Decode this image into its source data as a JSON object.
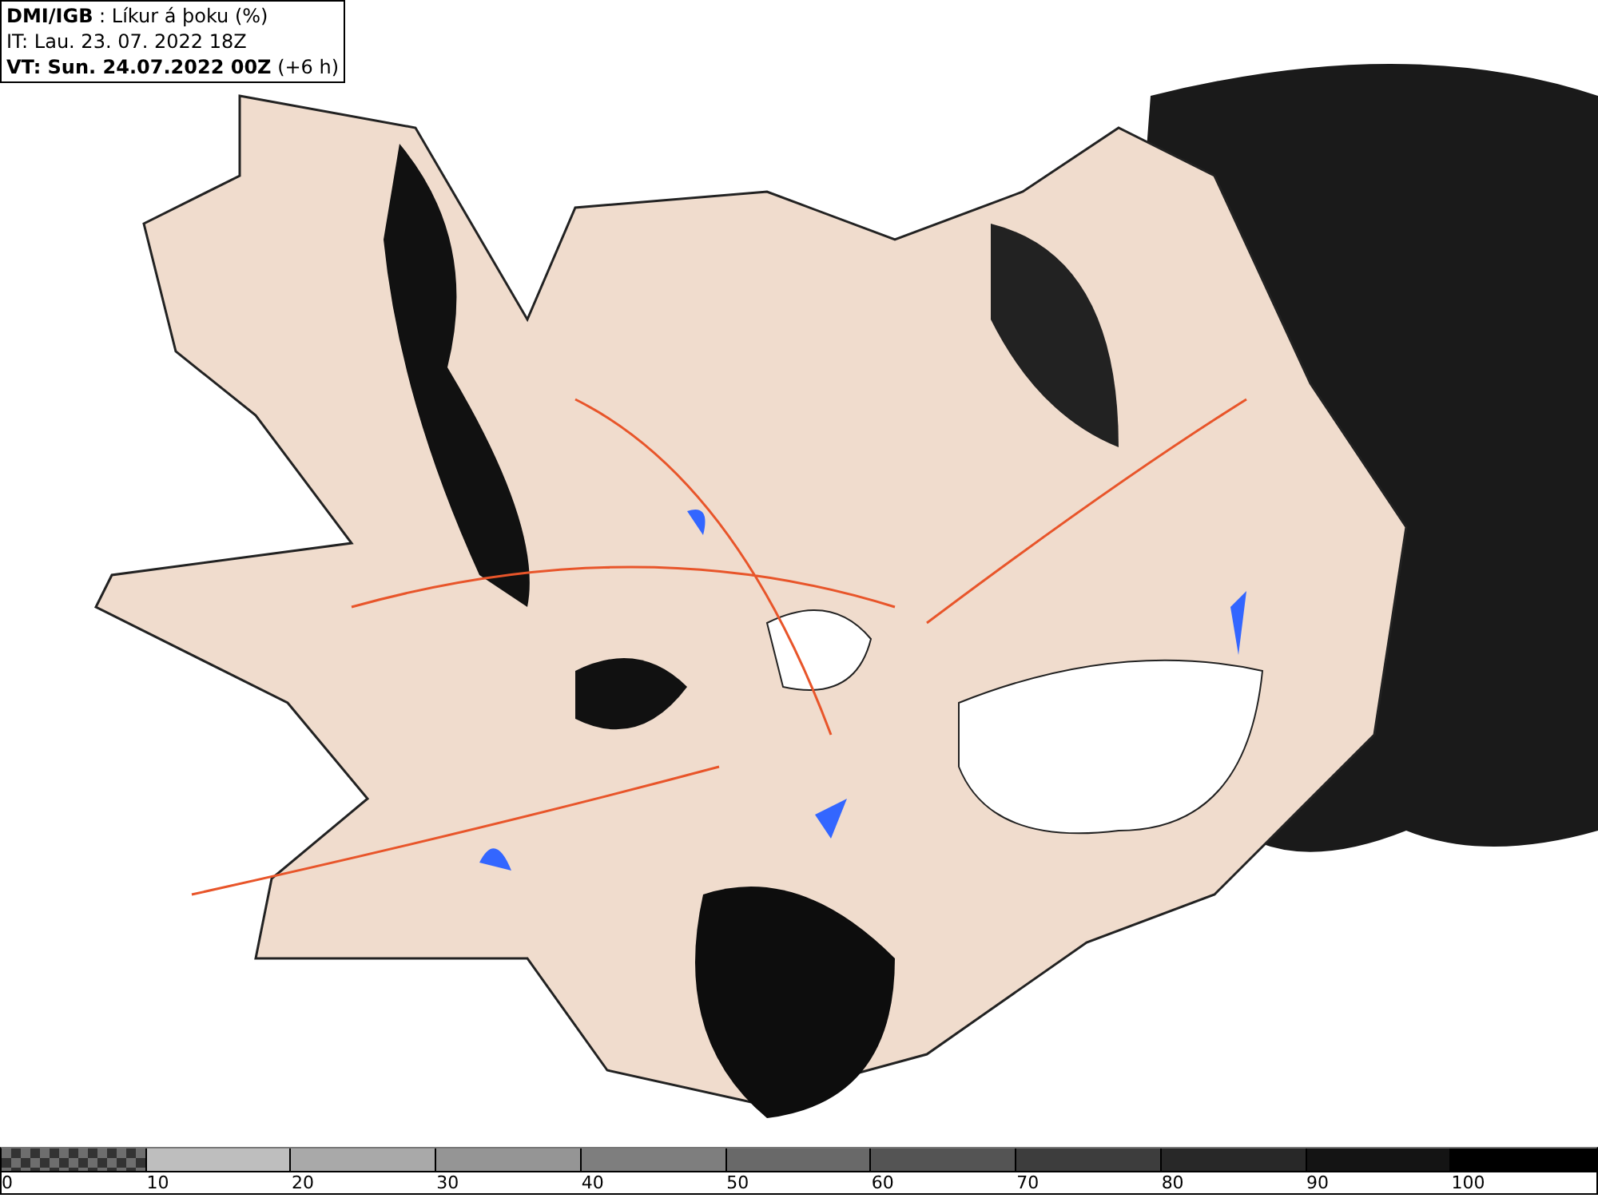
{
  "header": {
    "source": "DMI/IGB",
    "title": ": Líkur á þoku (%)",
    "issue_time": "IT: Lau. 23. 07. 2022 18Z",
    "valid_time": "VT: Sun. 24.07.2022 00Z",
    "valid_offset": "(+6 h)"
  },
  "legend": [
    {
      "label": "0",
      "kind": "checker",
      "color": "#6e6e6e"
    },
    {
      "label": "10",
      "kind": "solid",
      "color": "#bebebe"
    },
    {
      "label": "20",
      "kind": "solid",
      "color": "#a9a9a9"
    },
    {
      "label": "30",
      "kind": "solid",
      "color": "#959595"
    },
    {
      "label": "40",
      "kind": "solid",
      "color": "#7e7e7e"
    },
    {
      "label": "50",
      "kind": "solid",
      "color": "#696969"
    },
    {
      "label": "60",
      "kind": "solid",
      "color": "#545454"
    },
    {
      "label": "70",
      "kind": "solid",
      "color": "#3d3d3d"
    },
    {
      "label": "80",
      "kind": "solid",
      "color": "#282828"
    },
    {
      "label": "90",
      "kind": "solid",
      "color": "#141414"
    },
    {
      "label": "100",
      "kind": "solid",
      "color": "#000000"
    }
  ]
}
